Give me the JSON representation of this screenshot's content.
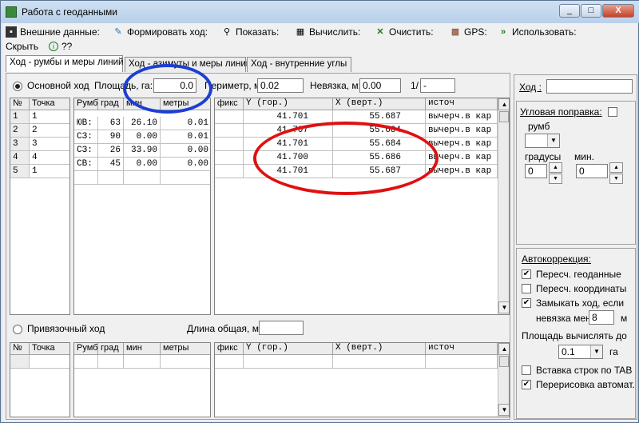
{
  "window": {
    "title": "Работа с геоданными",
    "min": "_",
    "max": "□",
    "close": "X"
  },
  "toolbar": [
    {
      "label": "Внешние данные:",
      "icon": "save-icon"
    },
    {
      "label": "Формировать ход:",
      "icon": "form-route-icon"
    },
    {
      "label": "Показать:",
      "icon": "magnifier-icon"
    },
    {
      "label": "Вычислить:",
      "icon": "calculator-icon"
    },
    {
      "label": "Очистить:",
      "icon": "clear-x-icon"
    },
    {
      "label": "GPS:",
      "icon": "gps-icon"
    },
    {
      "label": "Использовать:",
      "icon": "double-chevron-icon"
    },
    {
      "label": "Скрыть",
      "icon": "hide-icon"
    },
    {
      "label": "??",
      "icon": "info-icon"
    }
  ],
  "tabs": [
    "Ход - румбы и меры линий",
    "Ход - азимуты и меры линий",
    "Ход - внутренние углы"
  ],
  "main_route": {
    "radio_label": "Основной ход",
    "area_label": "Площадь, га:",
    "area_value": "0.0",
    "perimeter_label": "Периметр, м:",
    "perimeter_value": "0.02",
    "misclosure_label": "Невязка, м:",
    "misclosure_value": "0.00",
    "ratio_label": "1/",
    "ratio_value": "-"
  },
  "points_table": {
    "headers": [
      "№",
      "Точка"
    ],
    "rows": [
      [
        "1",
        "1"
      ],
      [
        "2",
        "2"
      ],
      [
        "3",
        "3"
      ],
      [
        "4",
        "4"
      ],
      [
        "5",
        "1"
      ]
    ]
  },
  "rhumbs_table": {
    "headers": [
      "Румб",
      "град",
      "мин",
      "метры"
    ],
    "rows": [
      [
        "ЮВ:",
        "63",
        "26.10",
        "0.01"
      ],
      [
        "СЗ:",
        "90",
        "0.00",
        "0.01"
      ],
      [
        "СЗ:",
        "26",
        "33.90",
        "0.00"
      ],
      [
        "СВ:",
        "45",
        "0.00",
        "0.00"
      ]
    ]
  },
  "coords_table": {
    "headers": [
      "фикс",
      "Y (гор.)",
      "X (верт.)",
      "источ"
    ],
    "rows": [
      [
        "",
        "41.701",
        "55.687",
        "вычерч.в кар"
      ],
      [
        "",
        "41.707",
        "55.684",
        "вычерч.в кар"
      ],
      [
        "",
        "41.701",
        "55.684",
        "вычерч.в кар"
      ],
      [
        "",
        "41.700",
        "55.686",
        "вычерч.в кар"
      ],
      [
        "",
        "41.701",
        "55.687",
        "вычерч.в кар"
      ]
    ]
  },
  "tie_route": {
    "radio_label": "Привязочный ход",
    "length_label": "Длина общая, м:",
    "length_value": ""
  },
  "tie_tables": {
    "points_headers": [
      "№",
      "Точка"
    ],
    "rhumbs_headers": [
      "Румб",
      "град",
      "мин",
      "метры"
    ],
    "coords_headers": [
      "фикс",
      "Y (гор.)",
      "X (верт.)",
      "источ"
    ]
  },
  "right_panel": {
    "route_label": "Ход :",
    "route_value": "",
    "angle_corr_label": "Угловая поправка:",
    "rhumb_label": "румб",
    "degrees_label": "градусы",
    "minutes_label": "мин.",
    "degrees_value": "0",
    "minutes_value": "0"
  },
  "autocorrection": {
    "title": "Автокоррекция:",
    "recalc_geo": {
      "label": "Пересч. геоданные",
      "checked": true
    },
    "recalc_coords": {
      "label": "Пересч. координаты",
      "checked": false
    },
    "close_route": {
      "label": "Замыкать ход, если",
      "checked": true
    },
    "misclosure_less_label": "невязка менее",
    "misclosure_less_value": "8",
    "misclosure_unit": "м",
    "area_calc_label": "Площадь вычислять до",
    "area_precision": "0.1",
    "area_unit": "га",
    "insert_tab": {
      "label": "Вставка строк по TAB",
      "checked": false
    },
    "auto_redraw": {
      "label": "Перерисовка автомат.",
      "checked": true
    }
  },
  "annotation_colors": {
    "blue_oval": "#1a3fd6",
    "red_oval": "#e01010"
  }
}
